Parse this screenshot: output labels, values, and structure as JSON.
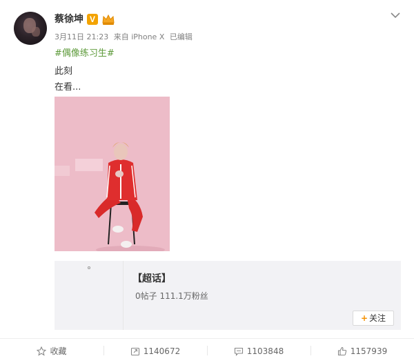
{
  "post": {
    "author": "蔡徐坤",
    "verified_badge": "V",
    "date": "3月11日 21:23",
    "source": "来自 iPhone X",
    "edited": "已编辑",
    "topic": "#偶像练习生#",
    "line1": "此刻",
    "line2": "在看..."
  },
  "supertopic": {
    "title": "【超话】",
    "stats": "0帖子 111.1万粉丝",
    "follow_label": "关注",
    "follow_plus": "+"
  },
  "actions": {
    "favorite_label": "收藏",
    "repost_count": "1140672",
    "comment_count": "1103848",
    "like_count": "1157939"
  },
  "colors": {
    "topic": "#5d9a3a",
    "badge": "#f3a300",
    "follow_plus": "#f59000"
  }
}
